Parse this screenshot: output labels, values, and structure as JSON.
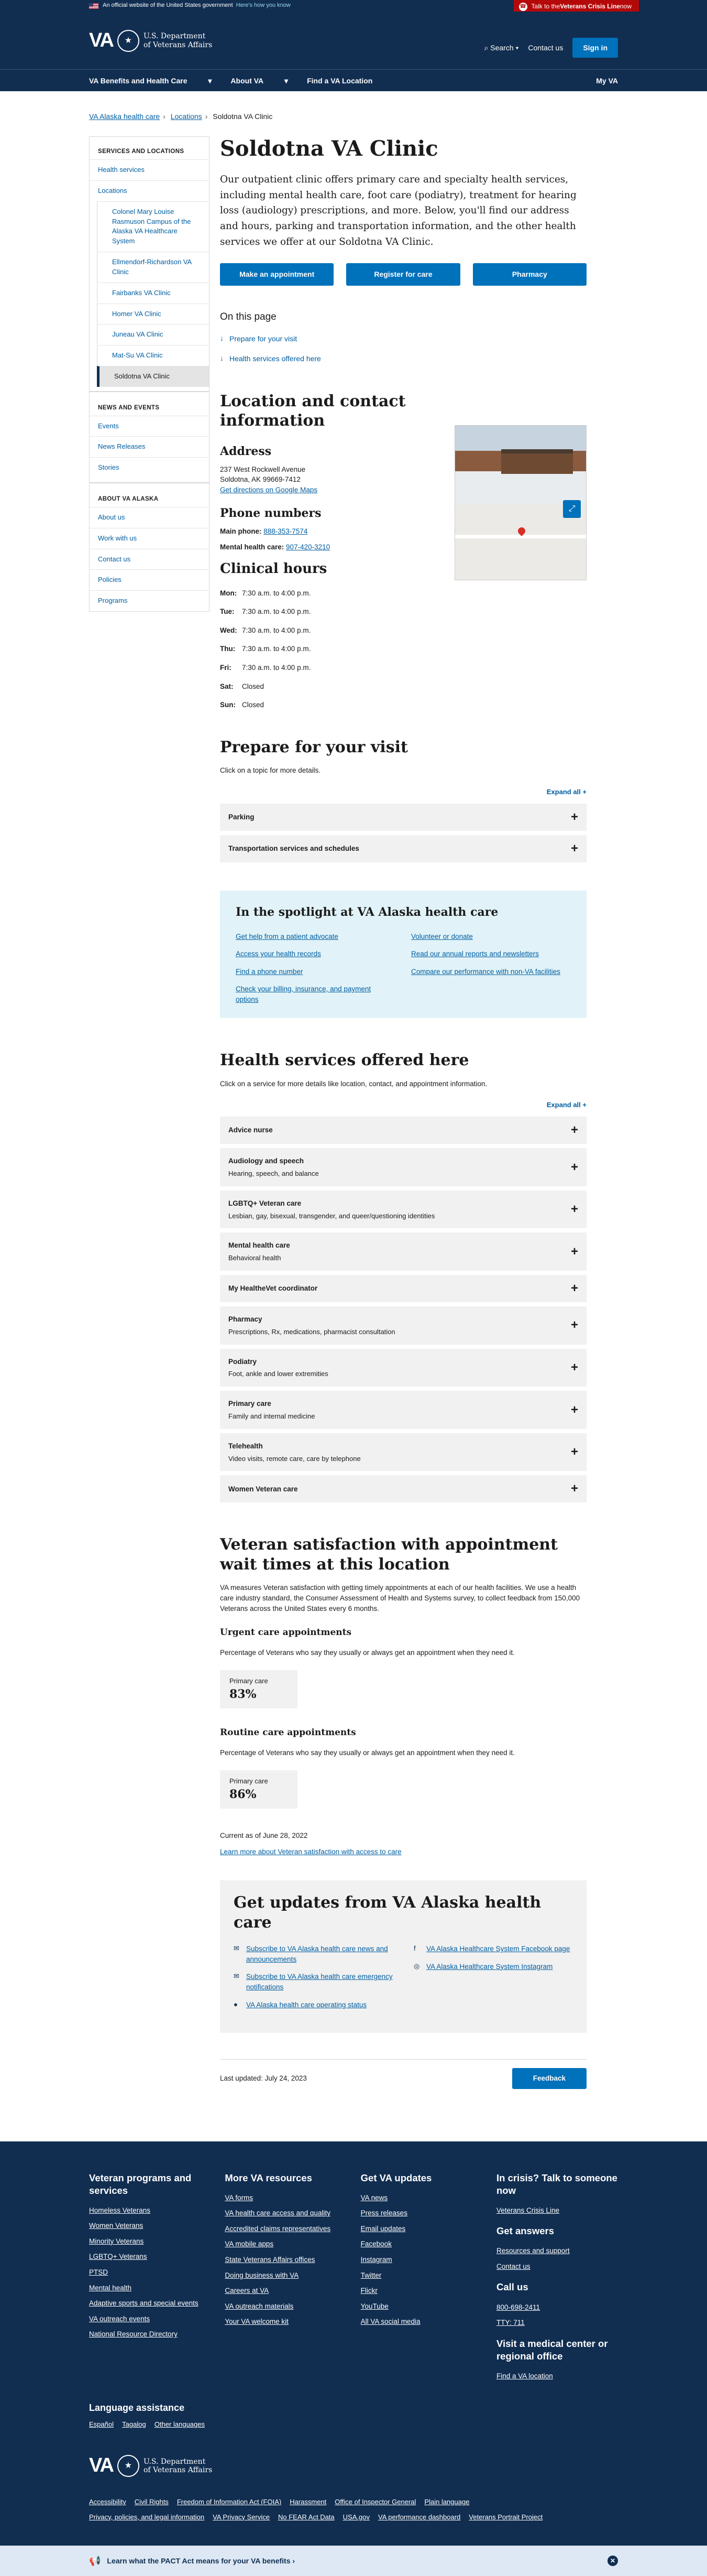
{
  "gov_banner": {
    "text": "An official website of the United States government",
    "know": "Here's how you know"
  },
  "crisis_line": {
    "prefix": "Talk to the ",
    "bold": "Veterans Crisis Line",
    "suffix": " now"
  },
  "header": {
    "logo_va": "VA",
    "dept_line1": "U.S. Department",
    "dept_line2": "of Veterans Affairs",
    "search": "Search",
    "contact": "Contact us",
    "signin": "Sign in"
  },
  "nav": {
    "items": [
      "VA Benefits and Health Care",
      "About VA",
      "Find a VA Location"
    ],
    "myva": "My VA"
  },
  "breadcrumb": [
    "VA Alaska health care",
    "Locations",
    "Soldotna VA Clinic"
  ],
  "sidenav": {
    "section1": "SERVICES AND LOCATIONS",
    "health_services": "Health services",
    "locations": "Locations",
    "locations_sub": [
      "Colonel Mary Louise Rasmuson Campus of the Alaska VA Healthcare System",
      "Ellmendorf-Richardson VA Clinic",
      "Fairbanks VA Clinic",
      "Homer VA Clinic",
      "Juneau VA Clinic",
      "Mat-Su VA Clinic",
      "Soldotna VA Clinic"
    ],
    "section2": "NEWS AND EVENTS",
    "news": [
      "Events",
      "News Releases",
      "Stories"
    ],
    "section3": "ABOUT VA ALASKA",
    "about": [
      "About us",
      "Work with us",
      "Contact us",
      "Policies",
      "Programs"
    ]
  },
  "page": {
    "title": "Soldotna VA Clinic",
    "intro": "Our outpatient clinic offers primary care and specialty health services, including mental health care, foot care (podiatry), treatment for hearing loss (audiology) prescriptions, and more. Below, you'll find our address and hours, parking and transportation information, and the other health services we offer at our Soldotna VA Clinic.",
    "buttons": [
      "Make an appointment",
      "Register for care",
      "Pharmacy"
    ],
    "on_this_page": "On this page",
    "jump_links": [
      "Prepare for your visit",
      "Health services offered here"
    ]
  },
  "location": {
    "title": "Location and contact information",
    "address_h": "Address",
    "address1": "237 West Rockwell Avenue",
    "address2": "Soldotna, AK 99669-7412",
    "directions": "Get directions on Google Maps",
    "phone_h": "Phone numbers",
    "main_label": "Main phone: ",
    "main_phone": "888-353-7574",
    "mh_label": "Mental health care: ",
    "mh_phone": "907-420-3210",
    "hours_h": "Clinical hours",
    "hours": [
      {
        "day": "Mon:",
        "time": "7:30 a.m. to 4:00 p.m."
      },
      {
        "day": "Tue:",
        "time": "7:30 a.m. to 4:00 p.m."
      },
      {
        "day": "Wed:",
        "time": "7:30 a.m. to 4:00 p.m."
      },
      {
        "day": "Thu:",
        "time": "7:30 a.m. to 4:00 p.m."
      },
      {
        "day": "Fri:",
        "time": "7:30 a.m. to 4:00 p.m."
      },
      {
        "day": "Sat:",
        "time": "Closed"
      },
      {
        "day": "Sun:",
        "time": "Closed"
      }
    ]
  },
  "prepare": {
    "title": "Prepare for your visit",
    "hint": "Click on a topic for more details.",
    "expand": "Expand all +",
    "items": [
      "Parking",
      "Transportation services and schedules"
    ]
  },
  "spotlight": {
    "title": "In the spotlight at VA Alaska health care",
    "links": [
      "Get help from a patient advocate",
      "Volunteer or donate",
      "Access your health records",
      "Read our annual reports and newsletters",
      "Find a phone number",
      "Compare our performance with non-VA facilities",
      "Check your billing, insurance, and payment options"
    ]
  },
  "services": {
    "title": "Health services offered here",
    "hint": "Click on a service for more details like location, contact, and appointment information.",
    "expand": "Expand all +",
    "items": [
      {
        "name": "Advice nurse",
        "desc": ""
      },
      {
        "name": "Audiology and speech",
        "desc": "Hearing, speech, and balance"
      },
      {
        "name": "LGBTQ+ Veteran care",
        "desc": "Lesbian, gay, bisexual, transgender, and queer/questioning identities"
      },
      {
        "name": "Mental health care",
        "desc": "Behavioral health"
      },
      {
        "name": "My HealtheVet coordinator",
        "desc": ""
      },
      {
        "name": "Pharmacy",
        "desc": "Prescriptions, Rx, medications, pharmacist consultation"
      },
      {
        "name": "Podiatry",
        "desc": "Foot, ankle and lower extremities"
      },
      {
        "name": "Primary care",
        "desc": "Family and internal medicine"
      },
      {
        "name": "Telehealth",
        "desc": "Video visits, remote care, care by telephone"
      },
      {
        "name": "Women Veteran care",
        "desc": ""
      }
    ]
  },
  "satisfaction": {
    "title": "Veteran satisfaction with appointment wait times at this location",
    "body": "VA measures Veteran satisfaction with getting timely appointments at each of our health facilities. We use a health care industry standard, the Consumer Assessment of Health and Systems survey, to collect feedback from 150,000 Veterans across the United States every 6 months.",
    "urgent_h": "Urgent care appointments",
    "urgent_p": "Percentage of Veterans who say they usually or always get an appointment when they need it.",
    "urgent_label": "Primary care",
    "urgent_val": "83%",
    "routine_h": "Routine care appointments",
    "routine_p": "Percentage of Veterans who say they usually or always get an appointment when they need it.",
    "routine_label": "Primary care",
    "routine_val": "86%",
    "current": "Current as of June 28, 2022",
    "learn": "Learn more about Veteran satisfaction with access to care"
  },
  "updates": {
    "title": "Get updates from VA Alaska health care",
    "left": [
      "Subscribe to VA Alaska health care news and announcements",
      "Subscribe to VA Alaska health care emergency notifications",
      "VA Alaska health care operating status"
    ],
    "right": [
      "VA Alaska Healthcare System Facebook page",
      "VA Alaska Healthcare System Instagram"
    ]
  },
  "last_updated": "Last updated: July 24, 2023",
  "feedback": "Feedback",
  "footer": {
    "col1_h": "Veteran programs and services",
    "col1": [
      "Homeless Veterans",
      "Women Veterans",
      "Minority Veterans",
      "LGBTQ+ Veterans",
      "PTSD",
      "Mental health",
      "Adaptive sports and special events",
      "VA outreach events",
      "National Resource Directory"
    ],
    "col2_h": "More VA resources",
    "col2": [
      "VA forms",
      "VA health care access and quality",
      "Accredited claims representatives",
      "VA mobile apps",
      "State Veterans Affairs offices",
      "Doing business with VA",
      "Careers at VA",
      "VA outreach materials",
      "Your VA welcome kit"
    ],
    "col3_h": "Get VA updates",
    "col3": [
      "VA news",
      "Press releases",
      "Email updates",
      "Facebook",
      "Instagram",
      "Twitter",
      "Flickr",
      "YouTube",
      "All VA social media"
    ],
    "col4_h1": "In crisis? Talk to someone now",
    "col4_l1": "Veterans Crisis Line",
    "col4_h2": "Get answers",
    "col4_l2": [
      "Resources and support",
      "Contact us"
    ],
    "col4_h3": "Call us",
    "col4_l3": [
      "800-698-2411",
      "TTY: 711"
    ],
    "col4_h4": "Visit a medical center or regional office",
    "col4_l4": "Find a VA location",
    "lang_h": "Language assistance",
    "lang": [
      "Español",
      "Tagalog",
      "Other languages"
    ],
    "links": [
      "Accessibility",
      "Civil Rights",
      "Freedom of Information Act (FOIA)",
      "Harassment",
      "Office of Inspector General",
      "Plain language",
      "Privacy, policies, and legal information",
      "VA Privacy Service",
      "No FEAR Act Data",
      "USA.gov",
      "VA performance dashboard",
      "Veterans Portrait Project"
    ]
  },
  "pact": "Learn what the PACT Act means for your VA benefits ›"
}
